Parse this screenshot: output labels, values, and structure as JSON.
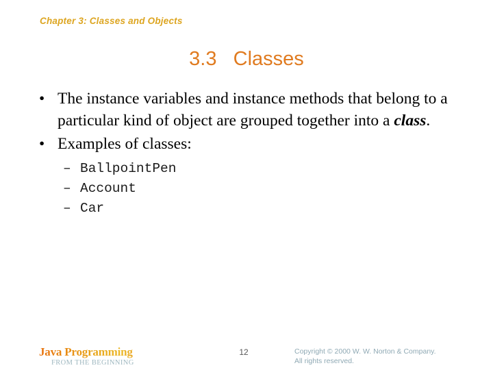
{
  "slide": {
    "header": "Chapter 3: Classes and Objects",
    "title": "3.3   Classes",
    "bullet_marker": "•",
    "sub_marker": "–",
    "bullets": [
      {
        "text_before": "The instance variables and instance methods that belong to a particular kind of object are grouped together into a ",
        "emphasis": "class",
        "text_after": "."
      },
      {
        "text_before": "Examples of classes:",
        "emphasis": "",
        "text_after": ""
      }
    ],
    "sub_items": [
      "BallpointPen",
      "Account",
      "Car"
    ]
  },
  "footer": {
    "brand_title": "Java Programming",
    "brand_sub": "FROM THE BEGINNING",
    "page_number": "12",
    "copyright_line1": "Copyright © 2000 W. W. Norton & Company.",
    "copyright_line2": "All rights reserved."
  },
  "colors": {
    "header_gold": "#dda520",
    "title_orange": "#e07b20",
    "body_black": "#000000",
    "brand_orange": "#e8720f",
    "brand_gold": "#ecb92b",
    "brand_sub_blue": "#9fb8c0",
    "copyright_blue": "#8fa9b4",
    "page_number_gray": "#575757",
    "background": "#ffffff"
  }
}
